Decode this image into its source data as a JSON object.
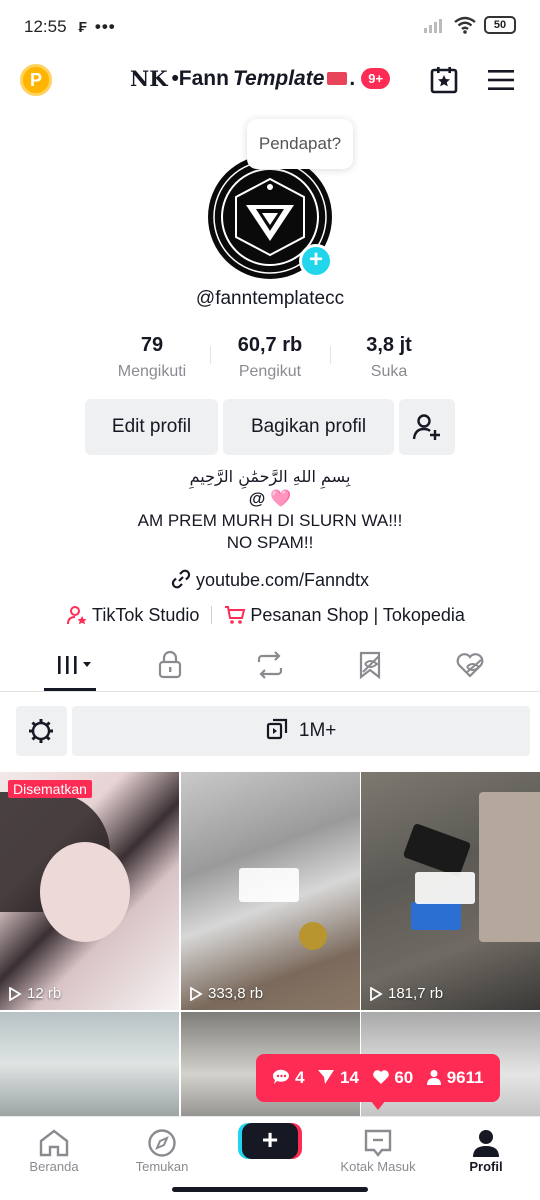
{
  "status_bar": {
    "time": "12:55",
    "battery": "50"
  },
  "header": {
    "coin_letter": "P",
    "title_part1": "NK",
    "title_part2": "•Fann",
    "title_part3": "Template",
    "title_dot": ".",
    "badge": "9+"
  },
  "profile": {
    "bubble": "Pendapat?",
    "avatar_plus": "+",
    "username": "@fanntemplatecc",
    "stats": [
      {
        "value": "79",
        "label": "Mengikuti"
      },
      {
        "value": "60,7 rb",
        "label": "Pengikut"
      },
      {
        "value": "3,8 jt",
        "label": "Suka"
      }
    ],
    "edit_label": "Edit profil",
    "share_label": "Bagikan profil",
    "bio_line1": "بِسمِ اللهِ الرَّحمَٰنِ الرَّحِيمِ",
    "bio_line2": "@ 🩷",
    "bio_line3": "AM PREM MURH DI SLURN WA!!!",
    "bio_line4": "NO SPAM!!",
    "link": "youtube.com/Fanndtx",
    "studio": "TikTok Studio",
    "shop": "Pesanan Shop | Tokopedia"
  },
  "content": {
    "count_label": "1M+",
    "pinned_label": "Disematkan",
    "videos": [
      {
        "views": "12 rb"
      },
      {
        "views": "333,8 rb"
      },
      {
        "views": "181,7 rb"
      }
    ]
  },
  "notification": {
    "comments": "4",
    "shares": "14",
    "likes": "60",
    "followers": "9611"
  },
  "bottom_nav": {
    "home": "Beranda",
    "discover": "Temukan",
    "create": "+",
    "inbox": "Kotak Masuk",
    "profile": "Profil"
  },
  "colors": {
    "accent": "#fe2c55",
    "cyan": "#20d5ec"
  }
}
